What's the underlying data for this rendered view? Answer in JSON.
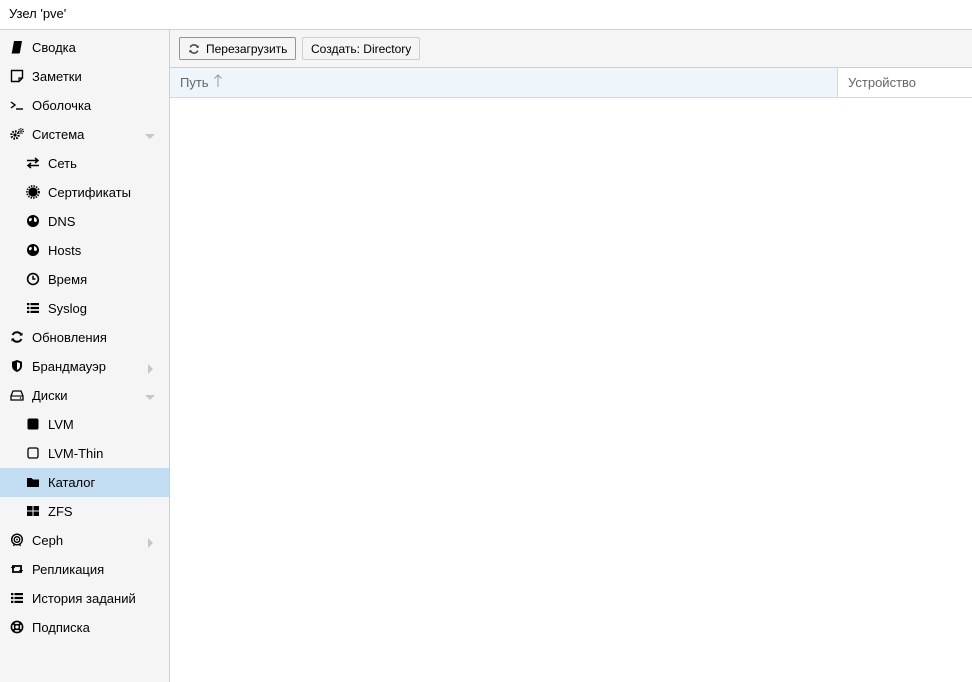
{
  "titlebar": {
    "title": "Узел 'pve'"
  },
  "sidebar": {
    "items": [
      {
        "label": "Сводка",
        "icon": "book-icon",
        "level": 0
      },
      {
        "label": "Заметки",
        "icon": "note-icon",
        "level": 0
      },
      {
        "label": "Оболочка",
        "icon": "terminal-icon",
        "level": 0
      },
      {
        "label": "Система",
        "icon": "gears-icon",
        "level": 0,
        "expandable": true,
        "expanded": true
      },
      {
        "label": "Сеть",
        "icon": "exchange-icon",
        "level": 1
      },
      {
        "label": "Сертификаты",
        "icon": "certificate-icon",
        "level": 1
      },
      {
        "label": "DNS",
        "icon": "globe-icon",
        "level": 1
      },
      {
        "label": "Hosts",
        "icon": "globe-icon",
        "level": 1
      },
      {
        "label": "Время",
        "icon": "clock-icon",
        "level": 1
      },
      {
        "label": "Syslog",
        "icon": "list-icon",
        "level": 1
      },
      {
        "label": "Обновления",
        "icon": "refresh-icon",
        "level": 0
      },
      {
        "label": "Брандмауэр",
        "icon": "shield-icon",
        "level": 0,
        "expandable": true,
        "expanded": false
      },
      {
        "label": "Диски",
        "icon": "hdd-icon",
        "level": 0,
        "expandable": true,
        "expanded": true
      },
      {
        "label": "LVM",
        "icon": "square-icon",
        "level": 1
      },
      {
        "label": "LVM-Thin",
        "icon": "square-outline-icon",
        "level": 1
      },
      {
        "label": "Каталог",
        "icon": "folder-icon",
        "level": 1,
        "selected": true
      },
      {
        "label": "ZFS",
        "icon": "grid-icon",
        "level": 1
      },
      {
        "label": "Ceph",
        "icon": "ceph-icon",
        "level": 0,
        "expandable": true,
        "expanded": false
      },
      {
        "label": "Репликация",
        "icon": "retweet-icon",
        "level": 0
      },
      {
        "label": "История заданий",
        "icon": "list-icon",
        "level": 0
      },
      {
        "label": "Подписка",
        "icon": "support-icon",
        "level": 0
      }
    ]
  },
  "toolbar": {
    "reload_label": "Перезагрузить",
    "create_label": "Создать: Directory"
  },
  "grid": {
    "columns": [
      "Путь",
      "Устройство"
    ],
    "sort_column": "Путь",
    "sort_direction": "ascending"
  },
  "colors": {
    "selected_bg": "#c2ddf2",
    "sidebar_bg": "#f5f5f5",
    "header_active_bg": "#eef6fc",
    "focus_border": "#5fa2dd"
  }
}
